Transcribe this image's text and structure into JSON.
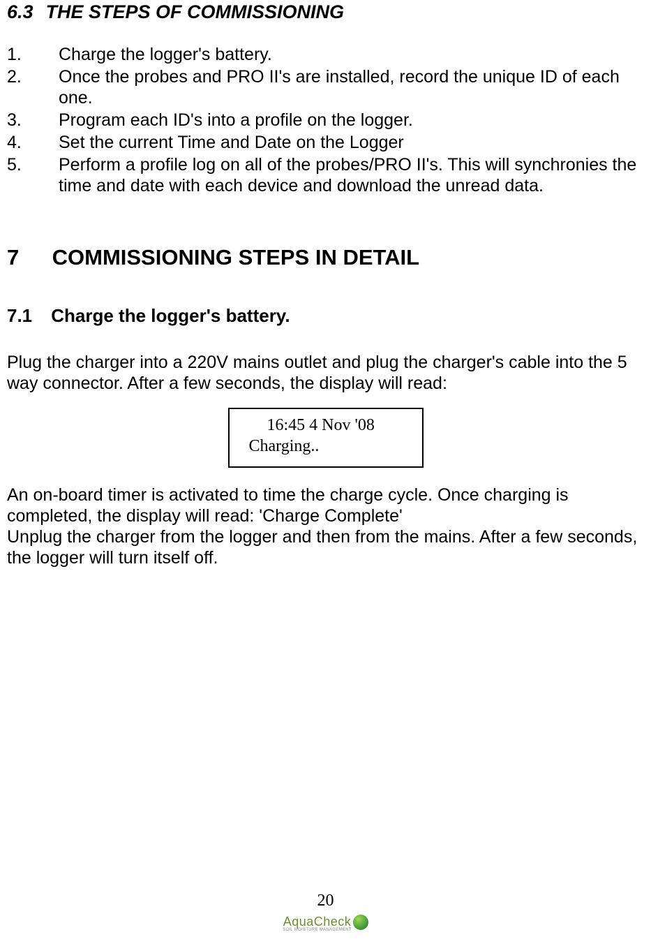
{
  "section63": {
    "number": "6.3",
    "title": "THE STEPS OF COMMISSIONING"
  },
  "steps": [
    {
      "num": "1.",
      "text": "Charge the logger's battery."
    },
    {
      "num": "2.",
      "text": "Once the probes and PRO II's are installed, record the unique ID of each one."
    },
    {
      "num": "3.",
      "text": "Program each ID's into a profile on the logger."
    },
    {
      "num": "4.",
      "text": "Set the current Time and Date on the Logger"
    },
    {
      "num": "5.",
      "text": "Perform a profile log on all of the probes/PRO II's. This will synchronies the time and date with each device and download the unread data."
    }
  ],
  "section7": {
    "number": "7",
    "title": "COMMISSIONING STEPS IN DETAIL"
  },
  "section71": {
    "number": "7.1",
    "title": "Charge the logger's battery."
  },
  "para1": "Plug the charger into a 220V mains outlet and plug the charger's cable into the 5 way connector.  After a few seconds, the display will read:",
  "display": {
    "line1": "16:45  4 Nov '08",
    "line2": "Charging.."
  },
  "para2": "An on-board timer is activated to time the charge cycle.  Once charging is completed, the display will read: 'Charge Complete'",
  "para3": "Unplug the charger from the logger and then from the mains.  After a few seconds, the logger will turn itself off.",
  "footer": {
    "pageNumber": "20",
    "logoAqua": "Aqua",
    "logoCheck": "Check",
    "logoSub": "SOIL MOISTURE MANAGEMENT"
  }
}
